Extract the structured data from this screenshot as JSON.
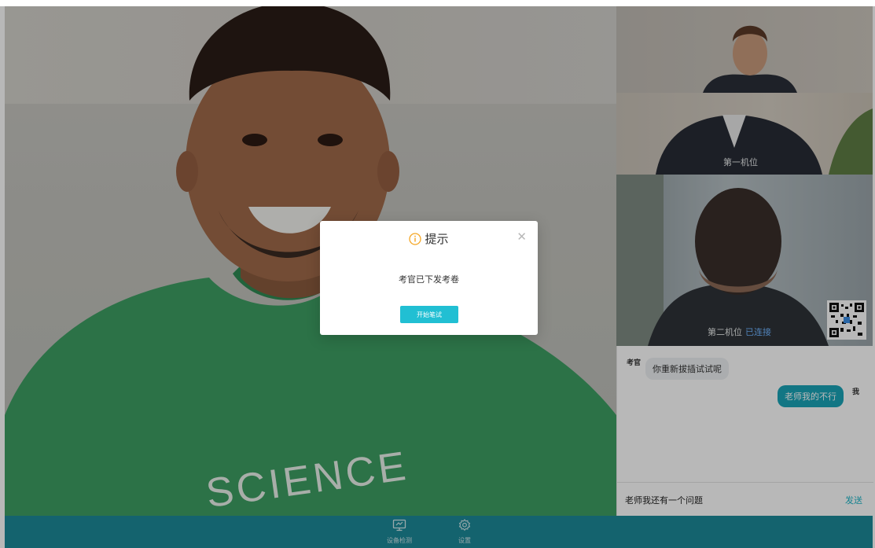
{
  "cameras": {
    "first": {
      "label": "第一机位"
    },
    "second": {
      "label": "第二机位",
      "status": "已连接"
    }
  },
  "chat": {
    "messages": [
      {
        "sender": "考官",
        "text": "你重新拔插试试呢",
        "side": "left"
      },
      {
        "sender": "我",
        "text": "老师我的不行",
        "side": "right"
      }
    ],
    "input_value": "老师我还有一个问题",
    "send_label": "发送"
  },
  "toolbar": {
    "device_check_label": "设备检测",
    "settings_label": "设置"
  },
  "modal": {
    "title": "提示",
    "message": "考官已下发考卷",
    "button_label": "开始笔试",
    "icon": "info-circle-icon",
    "close_icon": "close-icon"
  },
  "colors": {
    "accent": "#21bfd3",
    "bottom_bar": "#1d8a99",
    "info_icon": "#f5a623",
    "connected_status": "#6fb4ff",
    "outgoing_bubble": "#1aa4b8"
  }
}
